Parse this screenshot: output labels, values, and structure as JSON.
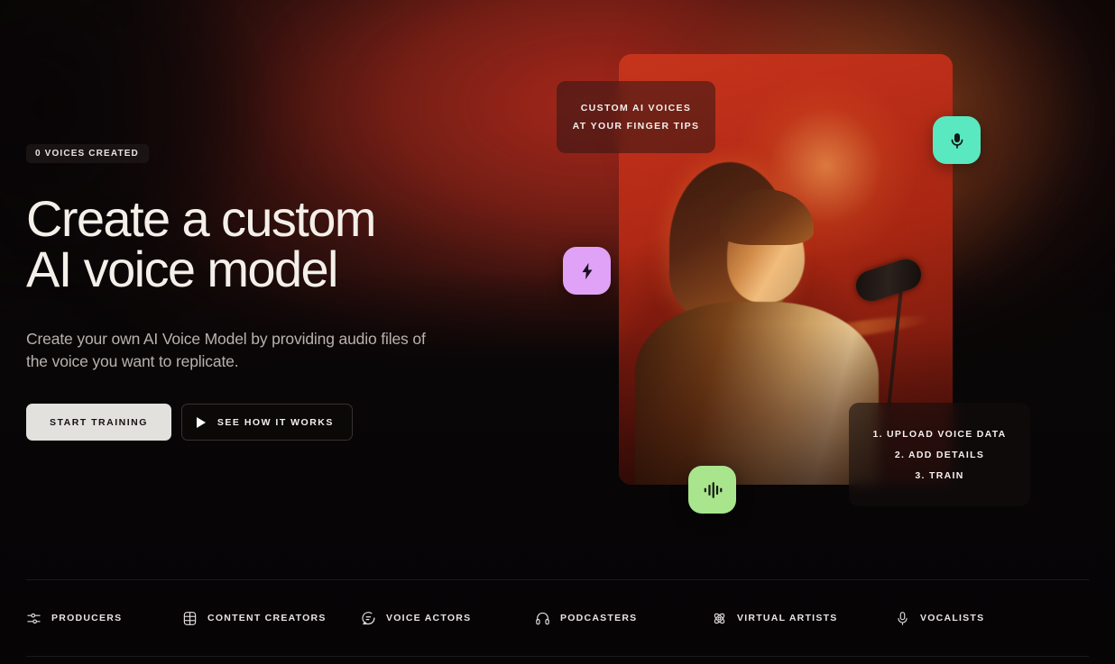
{
  "hero": {
    "badge": "0 VOICES CREATED",
    "title_line1": "Create a custom",
    "title_line2": "AI voice model",
    "subtitle": "Create your own AI Voice Model by providing audio files of the voice you want to replicate.",
    "primary_cta": "START TRAINING",
    "secondary_cta": "SEE HOW IT WORKS"
  },
  "tagline_card": {
    "line1": "CUSTOM AI VOICES",
    "line2": "AT YOUR FINGER TIPS"
  },
  "steps_card": {
    "step1": "1. UPLOAD VOICE DATA",
    "step2": "2. ADD DETAILS",
    "step3": "3. TRAIN"
  },
  "floating_badges": [
    {
      "icon": "microphone-icon",
      "color": "#5ae8c0"
    },
    {
      "icon": "lightning-bolt-icon",
      "color": "#dfa2f7"
    },
    {
      "icon": "audio-waveform-icon",
      "color": "#a8e58c"
    }
  ],
  "audience": [
    {
      "label": "PRODUCERS",
      "icon": "sliders-icon"
    },
    {
      "label": "CONTENT CREATORS",
      "icon": "film-grid-icon"
    },
    {
      "label": "VOICE ACTORS",
      "icon": "speech-bubble-icon"
    },
    {
      "label": "PODCASTERS",
      "icon": "headphones-icon"
    },
    {
      "label": "VIRTUAL ARTISTS",
      "icon": "atom-icon"
    },
    {
      "label": "VOCALISTS",
      "icon": "microphone-outline-icon"
    }
  ],
  "colors": {
    "background": "#090607",
    "glow_red": "#af291c",
    "text_primary": "#f4efe9",
    "text_muted": "#b9b2ae",
    "cta_primary_bg": "#e3e1de",
    "badge_mint": "#5ae8c0",
    "badge_lilac": "#dfa2f7",
    "badge_green": "#a8e58c"
  }
}
